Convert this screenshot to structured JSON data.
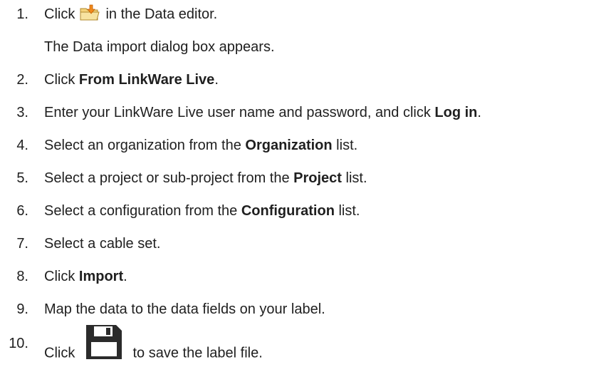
{
  "steps": [
    {
      "num": "1.",
      "pre": "Click",
      "post": "in the Data editor.",
      "icon": "open-folder-import-icon"
    },
    {
      "num": "2.",
      "pre": "Click ",
      "bold": "From LinkWare Live",
      "post": "."
    },
    {
      "num": "3.",
      "pre": "Enter your LinkWare Live user name and password, and click ",
      "bold": "Log in",
      "post": "."
    },
    {
      "num": "4.",
      "pre": "Select an organization from the ",
      "bold": "Organization",
      "post": " list."
    },
    {
      "num": "5.",
      "pre": "Select a project or sub-project from the ",
      "bold": "Project",
      "post": " list."
    },
    {
      "num": "6.",
      "pre": "Select a configuration from the ",
      "bold": "Configuration",
      "post": " list."
    },
    {
      "num": "7.",
      "pre": "Select a cable set."
    },
    {
      "num": "8.",
      "pre": "Click ",
      "bold": "Import",
      "post": "."
    },
    {
      "num": "9.",
      "pre": "Map the data to the data fields on your label."
    },
    {
      "num": "10.",
      "pre": "Click",
      "post": "to save the label file.",
      "icon": "save-floppy-icon"
    }
  ],
  "substep": "The Data import dialog box appears."
}
